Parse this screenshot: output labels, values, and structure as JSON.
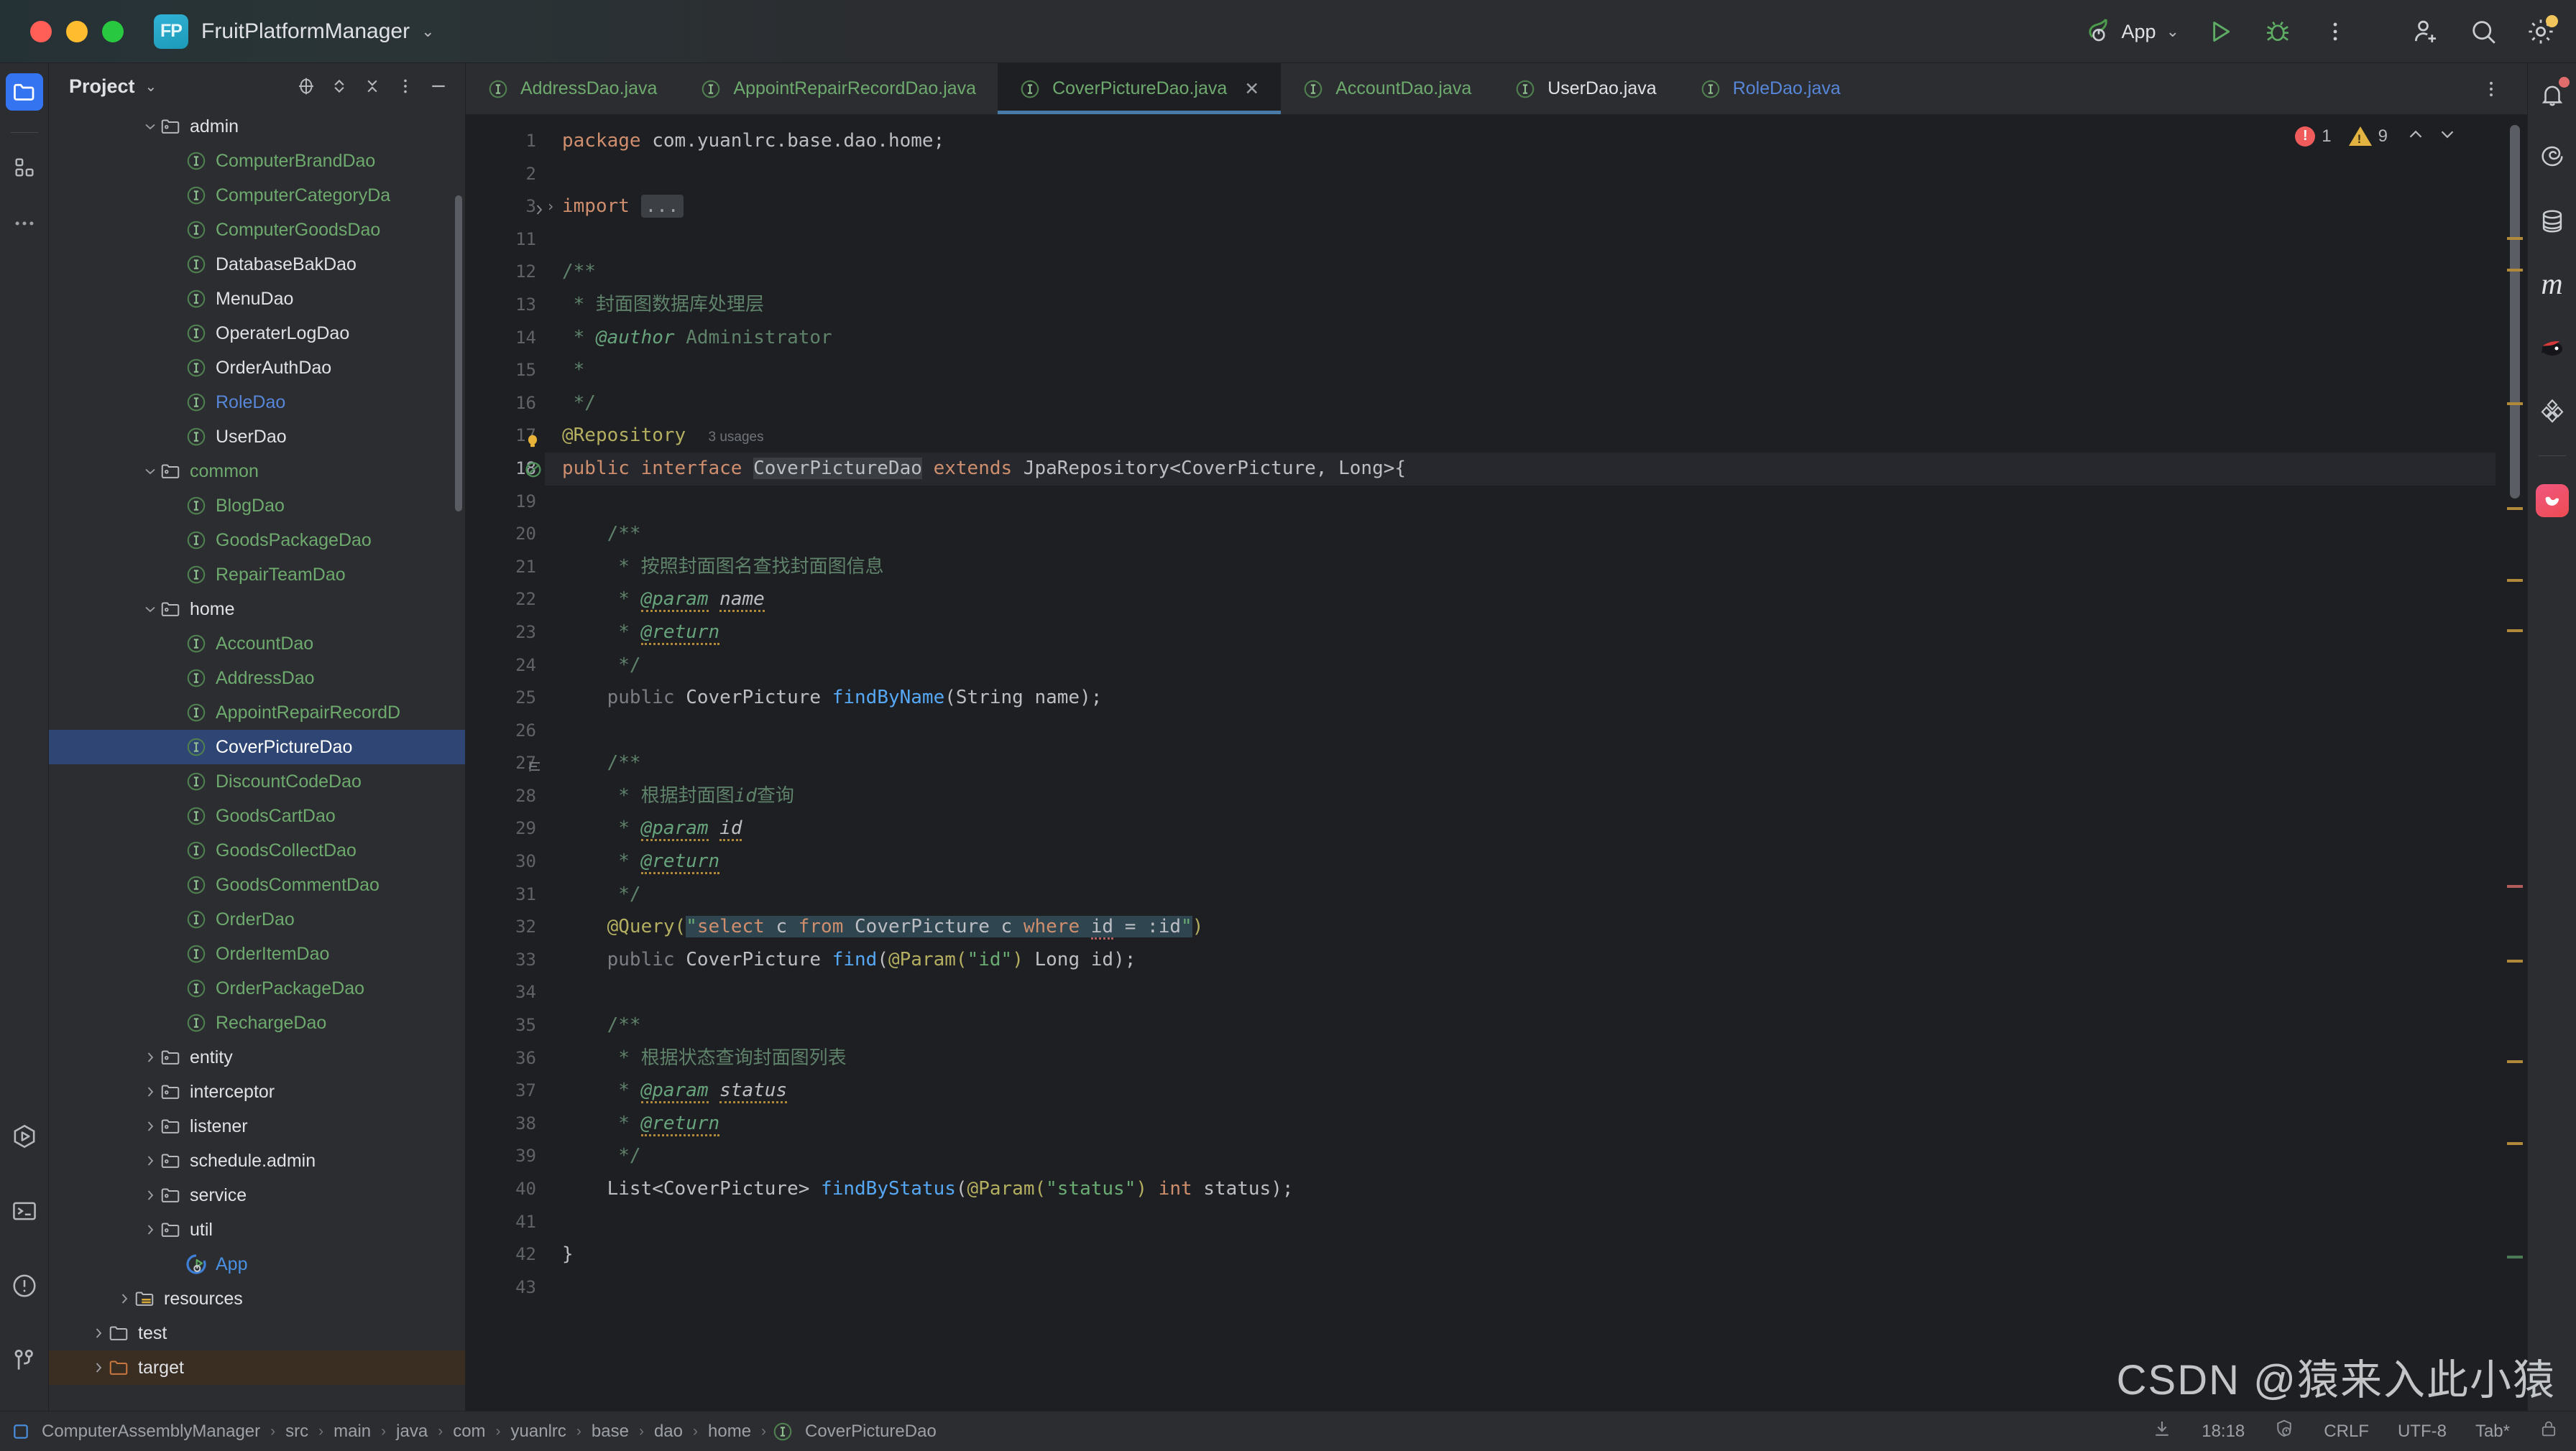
{
  "titlebar": {
    "project_initials": "FP",
    "project_name": "FruitPlatformManager",
    "dropdown_chevron": "chevron-down-icon",
    "run_config": "App",
    "buttons": {
      "run": "run-icon",
      "debug": "debug-icon",
      "more": "more-vertical-icon",
      "add_user": "add-user-icon",
      "search": "search-icon",
      "settings": "settings-icon"
    }
  },
  "left_strip": {
    "top": [
      {
        "name": "project-tool-window",
        "icon": "folder-icon",
        "active": true
      },
      {
        "name": "structure-tool-window",
        "icon": "blocks-icon",
        "active": false
      },
      {
        "name": "more-tool-windows",
        "icon": "ellipsis-icon",
        "active": false
      }
    ],
    "bottom": [
      {
        "name": "run-tool-window",
        "icon": "run-hex-icon"
      },
      {
        "name": "terminal-tool-window",
        "icon": "terminal-icon"
      },
      {
        "name": "problems-tool-window",
        "icon": "warning-circle-icon"
      },
      {
        "name": "version-control-tool-window",
        "icon": "branch-icon"
      }
    ]
  },
  "project_panel": {
    "title": "Project",
    "toolbar": [
      {
        "name": "select-opened-file-button",
        "icon": "crosshair-icon"
      },
      {
        "name": "expand-collapse-button",
        "icon": "chevron-updown-icon"
      },
      {
        "name": "collapse-all-button",
        "icon": "collapse-all-icon"
      },
      {
        "name": "options-button",
        "icon": "more-vertical-icon"
      },
      {
        "name": "hide-button",
        "icon": "minus-icon"
      }
    ],
    "tree": [
      {
        "label": "admin",
        "type": "folder",
        "depth": 3,
        "arrow": "down",
        "color": "white"
      },
      {
        "label": "ComputerBrandDao",
        "type": "interface",
        "depth": 4,
        "arrow": "none",
        "color": "green"
      },
      {
        "label": "ComputerCategoryDa",
        "type": "interface",
        "depth": 4,
        "arrow": "none",
        "color": "green"
      },
      {
        "label": "ComputerGoodsDao",
        "type": "interface",
        "depth": 4,
        "arrow": "none",
        "color": "green"
      },
      {
        "label": "DatabaseBakDao",
        "type": "interface",
        "depth": 4,
        "arrow": "none",
        "color": "white"
      },
      {
        "label": "MenuDao",
        "type": "interface",
        "depth": 4,
        "arrow": "none",
        "color": "white"
      },
      {
        "label": "OperaterLogDao",
        "type": "interface",
        "depth": 4,
        "arrow": "none",
        "color": "white"
      },
      {
        "label": "OrderAuthDao",
        "type": "interface",
        "depth": 4,
        "arrow": "none",
        "color": "white"
      },
      {
        "label": "RoleDao",
        "type": "interface",
        "depth": 4,
        "arrow": "none",
        "color": "blue"
      },
      {
        "label": "UserDao",
        "type": "interface",
        "depth": 4,
        "arrow": "none",
        "color": "white"
      },
      {
        "label": "common",
        "type": "folder",
        "depth": 3,
        "arrow": "down",
        "color": "green"
      },
      {
        "label": "BlogDao",
        "type": "interface",
        "depth": 4,
        "arrow": "none",
        "color": "green"
      },
      {
        "label": "GoodsPackageDao",
        "type": "interface",
        "depth": 4,
        "arrow": "none",
        "color": "green"
      },
      {
        "label": "RepairTeamDao",
        "type": "interface",
        "depth": 4,
        "arrow": "none",
        "color": "green"
      },
      {
        "label": "home",
        "type": "folder",
        "depth": 3,
        "arrow": "down",
        "color": "white"
      },
      {
        "label": "AccountDao",
        "type": "interface",
        "depth": 4,
        "arrow": "none",
        "color": "green"
      },
      {
        "label": "AddressDao",
        "type": "interface",
        "depth": 4,
        "arrow": "none",
        "color": "green"
      },
      {
        "label": "AppointRepairRecordD",
        "type": "interface",
        "depth": 4,
        "arrow": "none",
        "color": "green"
      },
      {
        "label": "CoverPictureDao",
        "type": "interface",
        "depth": 4,
        "arrow": "none",
        "color": "white",
        "selected": true
      },
      {
        "label": "DiscountCodeDao",
        "type": "interface",
        "depth": 4,
        "arrow": "none",
        "color": "green"
      },
      {
        "label": "GoodsCartDao",
        "type": "interface",
        "depth": 4,
        "arrow": "none",
        "color": "green"
      },
      {
        "label": "GoodsCollectDao",
        "type": "interface",
        "depth": 4,
        "arrow": "none",
        "color": "green"
      },
      {
        "label": "GoodsCommentDao",
        "type": "interface",
        "depth": 4,
        "arrow": "none",
        "color": "green"
      },
      {
        "label": "OrderDao",
        "type": "interface",
        "depth": 4,
        "arrow": "none",
        "color": "green"
      },
      {
        "label": "OrderItemDao",
        "type": "interface",
        "depth": 4,
        "arrow": "none",
        "color": "green"
      },
      {
        "label": "OrderPackageDao",
        "type": "interface",
        "depth": 4,
        "arrow": "none",
        "color": "green"
      },
      {
        "label": "RechargeDao",
        "type": "interface",
        "depth": 4,
        "arrow": "none",
        "color": "green"
      },
      {
        "label": "entity",
        "type": "folder",
        "depth": 3,
        "arrow": "right",
        "color": "white"
      },
      {
        "label": "interceptor",
        "type": "folder",
        "depth": 3,
        "arrow": "right",
        "color": "white"
      },
      {
        "label": "listener",
        "type": "folder",
        "depth": 3,
        "arrow": "right",
        "color": "white"
      },
      {
        "label": "schedule.admin",
        "type": "folder",
        "depth": 3,
        "arrow": "right",
        "color": "white"
      },
      {
        "label": "service",
        "type": "folder",
        "depth": 3,
        "arrow": "right",
        "color": "white"
      },
      {
        "label": "util",
        "type": "folder",
        "depth": 3,
        "arrow": "right",
        "color": "white"
      },
      {
        "label": "App",
        "type": "springapp",
        "depth": 4,
        "arrow": "none",
        "color": "blue2"
      },
      {
        "label": "resources",
        "type": "resfolder",
        "depth": 2,
        "arrow": "right",
        "color": "white"
      },
      {
        "label": "test",
        "type": "plainfolder",
        "depth": 1,
        "arrow": "right",
        "color": "white"
      },
      {
        "label": "target",
        "type": "excluded",
        "depth": 1,
        "arrow": "right",
        "color": "white"
      }
    ]
  },
  "tabs": [
    {
      "label": "AddressDao.java",
      "color": "green",
      "active": false,
      "closable": false
    },
    {
      "label": "AppointRepairRecordDao.java",
      "color": "green",
      "active": false,
      "closable": false
    },
    {
      "label": "CoverPictureDao.java",
      "color": "green",
      "active": true,
      "closable": true
    },
    {
      "label": "AccountDao.java",
      "color": "green",
      "active": false,
      "closable": false
    },
    {
      "label": "UserDao.java",
      "color": "white",
      "active": false,
      "closable": false
    },
    {
      "label": "RoleDao.java",
      "color": "blue",
      "active": false,
      "closable": false
    }
  ],
  "tabbar_more_icon": "more-vertical-icon",
  "editor": {
    "line_numbers": [
      "1",
      "2",
      "3",
      "11",
      "12",
      "13",
      "14",
      "15",
      "16",
      "17",
      "18",
      "19",
      "20",
      "21",
      "22",
      "23",
      "24",
      "25",
      "26",
      "27",
      "28",
      "29",
      "30",
      "31",
      "32",
      "33",
      "34",
      "35",
      "36",
      "37",
      "38",
      "39",
      "40",
      "41",
      "42",
      "43"
    ],
    "inspection": {
      "error_count": "1",
      "warning_count": "9",
      "up_icon": "chevron-up-icon",
      "down_icon": "chevron-down-icon"
    },
    "code_lines": [
      "package com.yuanlrc.base.dao.home;",
      "",
      "import ...",
      "",
      "/**",
      " * 封面图数据库处理层",
      " * @author Administrator",
      " *",
      " */",
      "@Repository   3 usages",
      "public interface CoverPictureDao extends JpaRepository<CoverPicture, Long>{",
      "",
      "    /**",
      "     * 按照封面图名查找封面图信息",
      "     * @param name",
      "     * @return",
      "     */",
      "    public CoverPicture findByName(String name);",
      "",
      "    /**",
      "     * 根据封面图id查询",
      "     * @param id",
      "     * @return",
      "     */",
      "    @Query(\"select c from CoverPicture c where id = :id\")",
      "    public CoverPicture find(@Param(\"id\") Long id);",
      "",
      "    /**",
      "     * 根据状态查询封面图列表",
      "     * @param status",
      "     * @return",
      "     */",
      "    List<CoverPicture> findByStatus(@Param(\"status\") int status);",
      "",
      "}",
      ""
    ],
    "usages_hint": "3 usages",
    "fold_placeholder": "..."
  },
  "right_strip": [
    {
      "name": "notifications-tool-window",
      "icon": "bell-icon",
      "badge": true
    },
    {
      "name": "spring-tool-window",
      "icon": "spiral-icon"
    },
    {
      "name": "database-tool-window",
      "icon": "database-icon"
    },
    {
      "name": "maven-tool-window",
      "icon": "maven-m-icon"
    },
    {
      "name": "ninja-plugin-tool-window",
      "icon": "ninja-icon"
    },
    {
      "name": "gradle-tool-window",
      "icon": "gradle-icon"
    },
    {
      "name": "ai-assistant-tool-window",
      "icon": "ai-app-icon"
    }
  ],
  "status_bar": {
    "breadcrumbs": [
      "ComputerAssemblyManager",
      "src",
      "main",
      "java",
      "com",
      "yuanlrc",
      "base",
      "dao",
      "home",
      "CoverPictureDao"
    ],
    "breadcrumb_separator": "›",
    "right": {
      "download_icon": "download-icon",
      "position": "18:18",
      "inspection_icon": "inspections-icon",
      "line_separator": "CRLF",
      "encoding": "UTF-8",
      "indent": "Tab*",
      "lock_icon": "lock-icon"
    }
  },
  "watermark": "CSDN @猿来入此小猿",
  "colors": {
    "accent_blue": "#3574f0",
    "selection_blue": "#2f4675",
    "vcs_green": "#6ea96e",
    "editor_bg": "#1e1f22",
    "panel_bg": "#2b2d30",
    "error_red": "#f05b5b",
    "warning_yellow": "#e3b341"
  }
}
